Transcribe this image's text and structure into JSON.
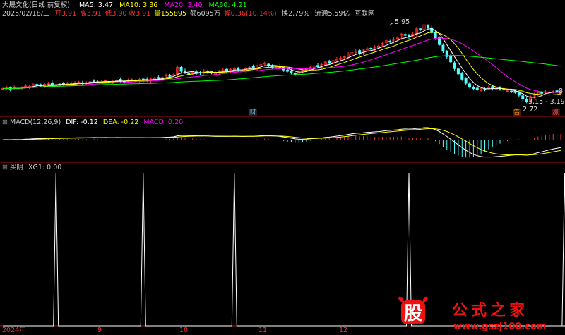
{
  "header": {
    "title": "大晟文化(日线 前复权)",
    "ma5": "MA5: 3.47",
    "ma10": "MA10: 3.36",
    "ma20": "MA20: 3.40",
    "ma60": "MA60: 4.21",
    "date": "2025/02/18/二",
    "open": "开3.91",
    "high": "高3.91",
    "low": "低3.90",
    "close": "收3.91",
    "vol": "量155895",
    "amount": "额6095万",
    "change": "幅0.36(10.14%)",
    "turnover": "换2.79%",
    "float": "流通5.59亿",
    "sector": "互联网"
  },
  "annotations": {
    "high": "5.95",
    "low": "2.72",
    "range": "3.15 - 3.19",
    "cai": "财",
    "gao": "告",
    "zhang": "涨",
    "eight": "8"
  },
  "macd_header": {
    "name": "MACD(12,26,9)",
    "dif": "DIF: -0.12",
    "dea": "DEA: -0.22",
    "macd": "MACD: 0.20"
  },
  "xg_header": {
    "name": "买阴",
    "xg": "XG1: 0.00"
  },
  "x_axis": [
    "2024年",
    "9",
    "10",
    "11",
    "12"
  ],
  "watermark": {
    "stamp": "股",
    "name": "公式之家",
    "url": "www.gszj100.com"
  },
  "colors": {
    "up": "#ff3232",
    "down": "#54ffff",
    "ma5": "#ffffff",
    "ma10": "#ffff00",
    "ma20": "#ff00ff",
    "ma60": "#00ff00",
    "divider": "#b01010"
  },
  "chart_data": [
    {
      "type": "candlestick",
      "title": "大晟文化(日线 前复权)",
      "price_ticks": {
        "high": 5.95,
        "low": 2.72,
        "last_range": [
          3.15,
          3.19
        ]
      },
      "series": [
        {
          "name": "MA5",
          "last": 3.47
        },
        {
          "name": "MA10",
          "last": 3.36
        },
        {
          "name": "MA20",
          "last": 3.4
        },
        {
          "name": "MA60",
          "last": 4.21
        }
      ],
      "closes": [
        3.3,
        3.32,
        3.28,
        3.34,
        3.3,
        3.35,
        3.4,
        3.38,
        3.45,
        3.42,
        3.4,
        3.46,
        3.5,
        3.44,
        3.42,
        3.48,
        3.46,
        3.5,
        3.47,
        3.52,
        3.55,
        3.5,
        3.52,
        3.56,
        3.58,
        3.54,
        3.56,
        3.6,
        3.55,
        3.58,
        3.62,
        3.6,
        3.57,
        3.6,
        3.64,
        3.6,
        3.65,
        3.62,
        3.6,
        3.66,
        3.7,
        3.68,
        3.72,
        3.78,
        3.76,
        3.82,
        4.1,
        3.95,
        3.9,
        3.86,
        3.92,
        3.88,
        3.9,
        3.95,
        3.92,
        3.88,
        3.9,
        3.95,
        4.0,
        3.96,
        4.02,
        4.05,
        4.0,
        3.98,
        4.05,
        4.1,
        4.08,
        4.15,
        4.2,
        4.25,
        4.15,
        4.1,
        4.12,
        4.08,
        4.0,
        3.95,
        3.9,
        3.85,
        3.92,
        4.0,
        4.05,
        4.1,
        4.15,
        4.12,
        4.2,
        4.3,
        4.25,
        4.35,
        4.4,
        4.45,
        4.5,
        4.6,
        4.65,
        4.7,
        4.62,
        4.75,
        4.8,
        4.78,
        4.85,
        4.9,
        5.0,
        5.1,
        5.05,
        5.15,
        5.2,
        5.35,
        5.3,
        5.25,
        5.35,
        5.55,
        5.5,
        5.7,
        5.6,
        5.4,
        5.2,
        4.95,
        4.7,
        4.5,
        4.3,
        4.05,
        3.85,
        3.65,
        3.5,
        3.35,
        3.3,
        3.25,
        3.3,
        3.28,
        3.35,
        3.3,
        3.32,
        3.28,
        3.25,
        3.22,
        3.2,
        3.15,
        3.05,
        2.9,
        2.8,
        3.0,
        3.1,
        3.15,
        3.12,
        3.18,
        3.16,
        3.2,
        3.15,
        3.19
      ],
      "macd": {
        "dif": -0.12,
        "dea": -0.22,
        "macd": 0.2
      }
    },
    {
      "type": "line",
      "title": "买阴",
      "series": [
        {
          "name": "XG1",
          "last": 0.0
        }
      ],
      "signals_x_index": [
        14,
        37,
        61,
        107,
        148
      ],
      "ylim": [
        0,
        1
      ]
    }
  ]
}
